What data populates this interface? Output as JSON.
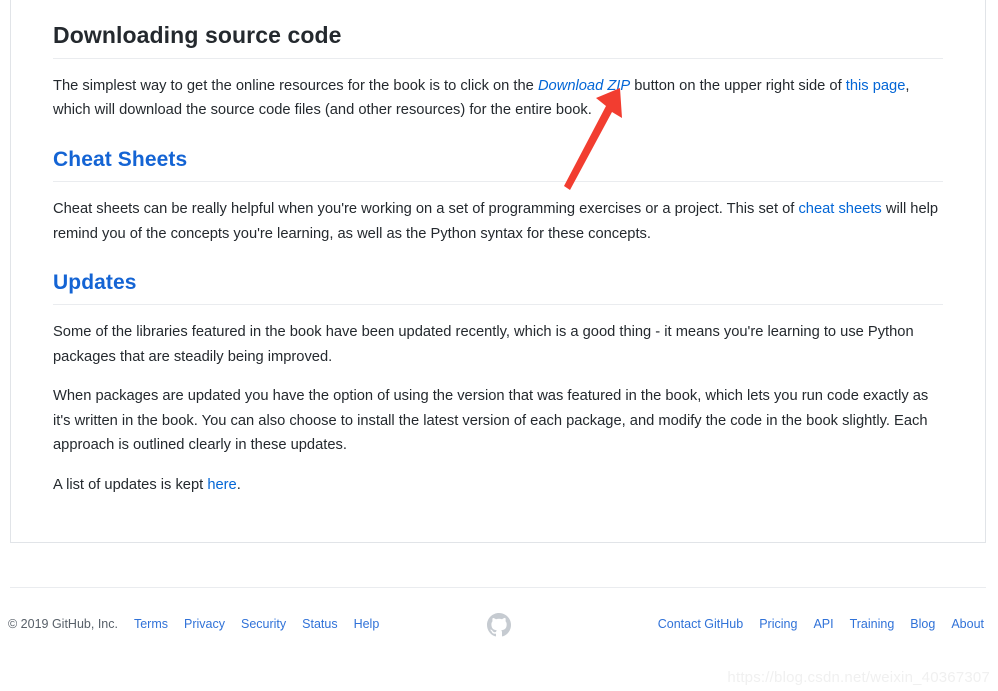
{
  "document": {
    "sections": [
      {
        "id": "downloading-source-code",
        "heading": "Downloading source code",
        "heading_level": "h1",
        "heading_color": "#24292e"
      },
      {
        "id": "cheat-sheets",
        "heading": "Cheat Sheets",
        "heading_level": "h2",
        "heading_color": "#1464d4"
      },
      {
        "id": "updates",
        "heading": "Updates",
        "heading_level": "h2",
        "heading_color": "#1464d4"
      }
    ],
    "paragraphs": {
      "download_p1_a": "The simplest way to get the online resources for the book is to click on the ",
      "download_link_zip": "Download ZIP",
      "download_p1_b": " button on the upper right side of ",
      "download_link_thispage": "this page",
      "download_p1_c": ", which will download the source code files (and other resources) for the entire book.",
      "cheat_p1_a": "Cheat sheets can be really helpful when you're working on a set of programming exercises or a project. This set of ",
      "cheat_link": "cheat sheets",
      "cheat_p1_b": " will help remind you of the concepts you're learning, as well as the Python syntax for these concepts.",
      "updates_p1": "Some of the libraries featured in the book have been updated recently, which is a good thing - it means you're learning to use Python packages that are steadily being improved.",
      "updates_p2": "When packages are updated you have the option of using the version that was featured in the book, which lets you run code exactly as it's written in the book. You can also choose to install the latest version of each package, and modify the code in the book slightly. Each approach is outlined clearly in these updates.",
      "updates_p3_a": "A list of updates is kept ",
      "updates_link_here": "here",
      "updates_p3_b": "."
    }
  },
  "annotation": {
    "type": "arrow",
    "color": "#f23d30",
    "points_to": "Download ZIP"
  },
  "footer": {
    "copyright": "© 2019 GitHub, Inc.",
    "left_links": [
      {
        "label": "Terms"
      },
      {
        "label": "Privacy"
      },
      {
        "label": "Security"
      },
      {
        "label": "Status"
      },
      {
        "label": "Help"
      }
    ],
    "right_links": [
      {
        "label": "Contact GitHub"
      },
      {
        "label": "Pricing"
      },
      {
        "label": "API"
      },
      {
        "label": "Training"
      },
      {
        "label": "Blog"
      },
      {
        "label": "About"
      }
    ],
    "logo": "github-octocat-icon",
    "link_color": "#3072d8"
  },
  "watermark": {
    "text": "https://blog.csdn.net/weixin_40367307"
  }
}
